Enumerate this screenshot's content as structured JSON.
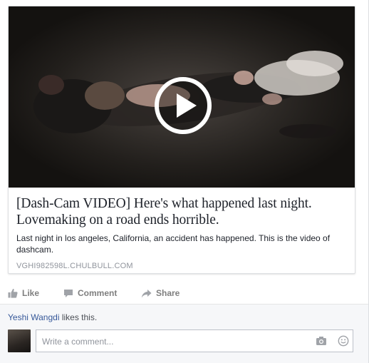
{
  "link_preview": {
    "title": "[Dash-Cam VIDEO] Here's what happened last night. Lovemaking on a road ends horrible.",
    "description": "Last night in los angeles, California, an accident has happened. This is the video of dashcam.",
    "domain": "VGHI982598L.CHULBULL.COM",
    "image_icon": "play-icon"
  },
  "actions": {
    "like_label": "Like",
    "comment_label": "Comment",
    "share_label": "Share"
  },
  "likes": {
    "user": "Yeshi Wangdi",
    "suffix": " likes this."
  },
  "comment": {
    "placeholder": "Write a comment..."
  },
  "icons": [
    "thumbs-up-icon",
    "comment-icon",
    "share-icon",
    "camera-icon",
    "emoji-icon"
  ],
  "colors": {
    "link_blue": "#365899",
    "text": "#1d2129",
    "muted": "#90949c",
    "action_gray": "#7f7f7f"
  }
}
